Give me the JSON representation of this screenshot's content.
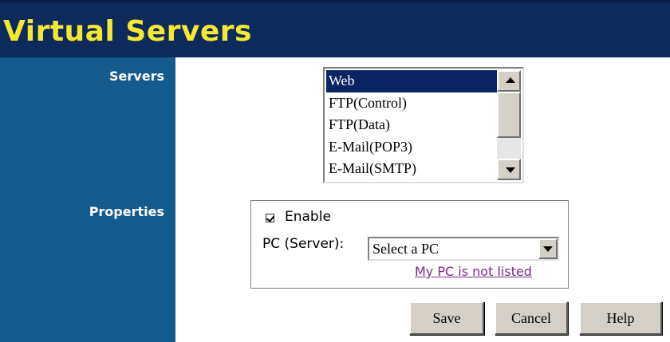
{
  "header": {
    "title": "Virtual Servers"
  },
  "sidebar": {
    "servers_label": "Servers",
    "properties_label": "Properties"
  },
  "servers_list": {
    "items": [
      "Web",
      "FTP(Control)",
      "FTP(Data)",
      "E-Mail(POP3)",
      "E-Mail(SMTP)"
    ],
    "selected": "Web"
  },
  "properties": {
    "enable_label": "Enable",
    "enable_checked": true,
    "pc_label": "PC (Server):",
    "pc_select_value": "Select a PC",
    "link_text": "My PC is not listed"
  },
  "buttons": {
    "save": "Save",
    "cancel": "Cancel",
    "help": "Help"
  },
  "colors": {
    "header_bg": "#0d2a5c",
    "title_color": "#f4e830",
    "sidebar_bg": "#145a8c",
    "selection_bg": "#0b2463",
    "link_color": "#7a2a8a"
  },
  "icons": {
    "scroll_up": "triangle-up-icon",
    "scroll_down": "triangle-down-icon",
    "dropdown": "chevron-down-icon",
    "checkbox": "checkmark-icon"
  }
}
